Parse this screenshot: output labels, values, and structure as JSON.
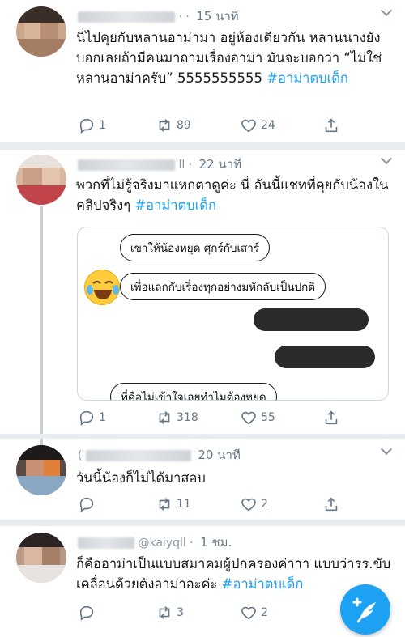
{
  "tweets": [
    {
      "handle": "· ·",
      "time": "15 นาที",
      "text_plain": "นี่ไปคุยกับหลานอาม่ามา อยู่ห้องเดียวกัน หลานนางยังบอกเลยถ้ามีคนมาถามเรื่องอาม่า มันจะบอกว่า “ไม่ใช่หลานอาม่าครับ” 5555555555",
      "hashtag": "#อาม่าตบเด็ก",
      "replies": "1",
      "retweets": "89",
      "likes": "24"
    },
    {
      "handle": "ll ·",
      "time": "22 นาที",
      "text_plain": "พวกที่ไม่รู้จริงมาแหกตาดูค่ะ นี่ อันนี้แชทที่คุยกับน้องในคลิปจริงๆ",
      "hashtag": "#อาม่าตบเด็ก",
      "replies": "1",
      "retweets": "318",
      "likes": "55",
      "chat": {
        "msg1": "เขาให้น้องหยุด ศุกร์กับเสาร์",
        "msg2": "เพื่อแลกกับเรื่องทุกอย่างมหักลับเป็นปกติ",
        "msg3": "ที่คือไม่เข้าใจเลยทำไมต้องหยุด"
      }
    },
    {
      "handle": "(",
      "time": "20 นาที",
      "text_plain": "วันนี้น้องก็ไม่ได้มาสอบ",
      "replies": "",
      "retweets": "11",
      "likes": "2"
    },
    {
      "handle": "@kaiyqll ·",
      "time": "1 ชม.",
      "text_plain": "ก็คืออาม่าเป็นแบบสมาคมผู้ปกครองค่าาา แบบว่ารร.ขับเคลื่อนด้วยตังอาม่าอะค่ะ",
      "hashtag": "#อาม่าตบเด็ก",
      "replies": "",
      "retweets": "3",
      "likes": "2"
    }
  ],
  "icons": {
    "reply": "reply-icon",
    "retweet": "retweet-icon",
    "like": "heart-icon",
    "share": "share-icon",
    "compose": "compose-tweet-icon"
  },
  "colors": {
    "accent": "#1da1f2",
    "divider": "#e6ecf0",
    "muted": "#657786"
  }
}
